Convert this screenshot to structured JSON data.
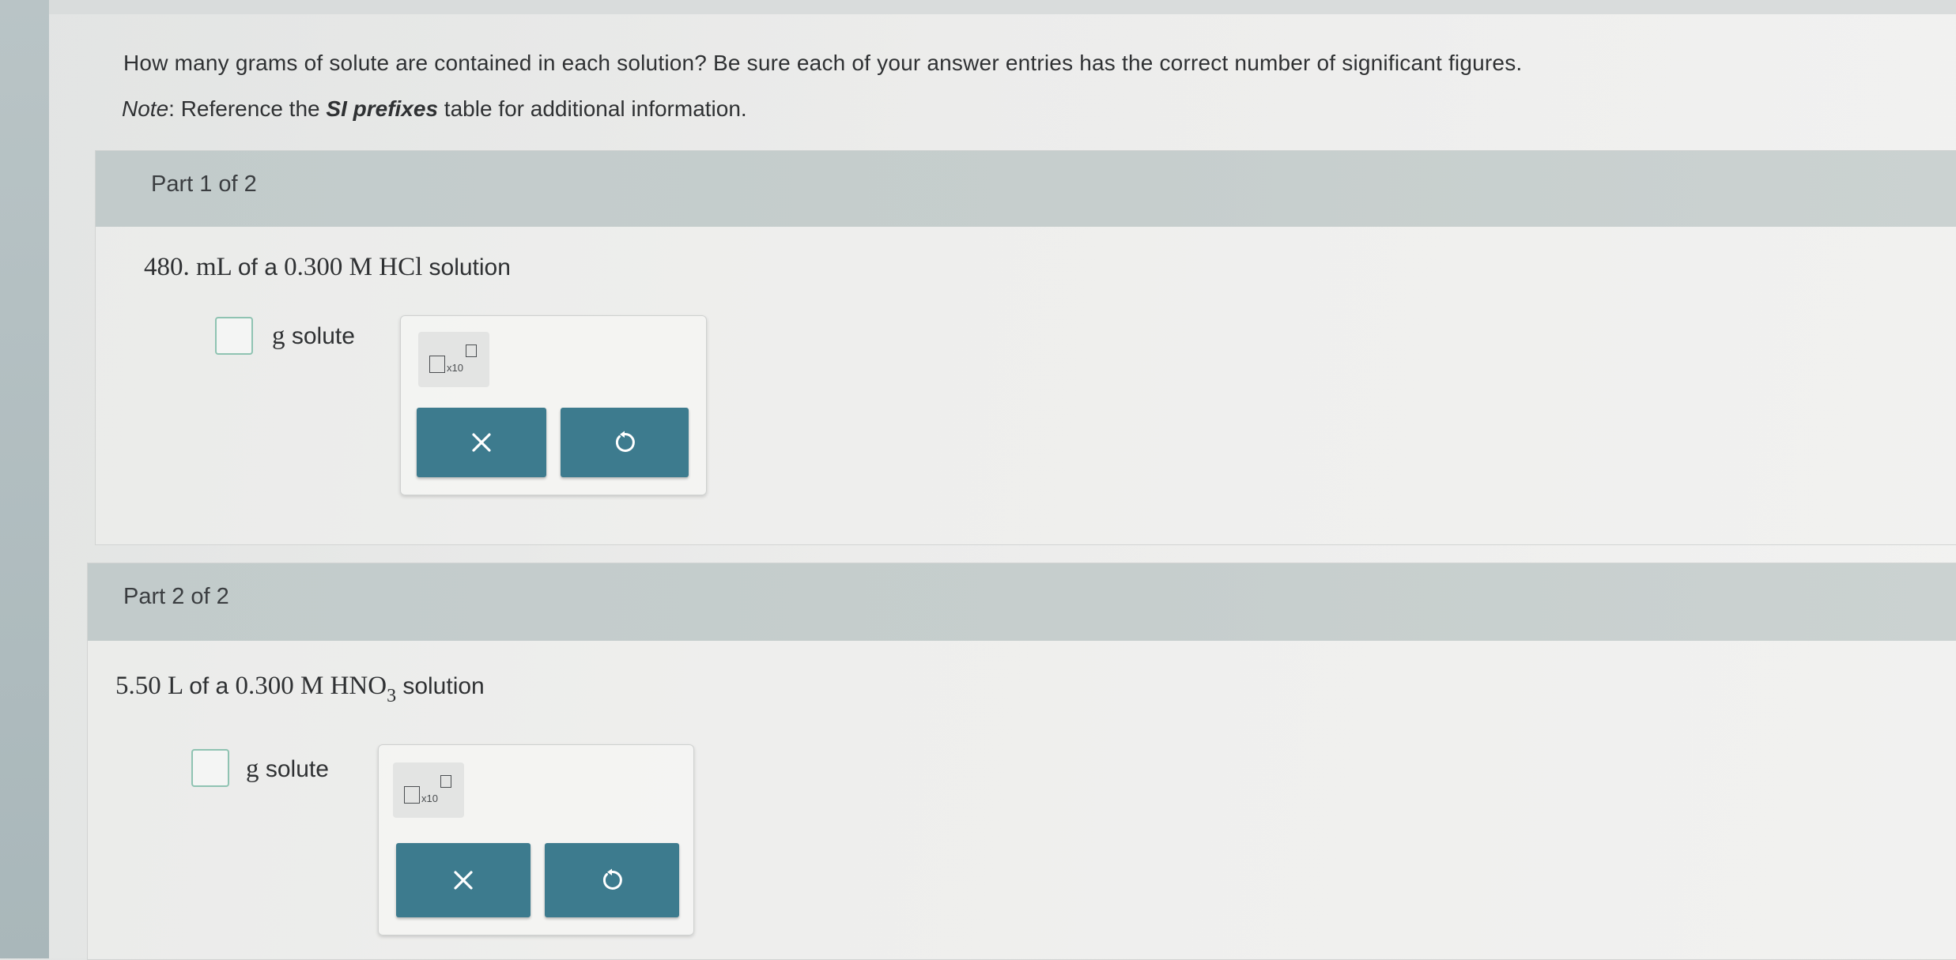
{
  "question": {
    "text": "How many grams of solute are contained in each solution? Be sure each of your answer entries has the correct number of significant figures.",
    "note_label": "Note",
    "note_prefix": ": Reference the ",
    "note_emphasis": "SI prefixes",
    "note_suffix": " table for additional information."
  },
  "parts": [
    {
      "title": "Part 1 of 2",
      "problem_amount": "480. mL",
      "problem_of": "of a",
      "problem_conc": "0.300 M HCl",
      "problem_formula_sub": "",
      "problem_suffix": "solution",
      "unit_g": "g",
      "unit_text": "solute",
      "sci_x10": "x10"
    },
    {
      "title": "Part 2 of 2",
      "problem_amount": "5.50 L",
      "problem_of": "of a",
      "problem_conc": "0.300 M HNO",
      "problem_formula_sub": "3",
      "problem_suffix": "solution",
      "unit_g": "g",
      "unit_text": "solute",
      "sci_x10": "x10"
    }
  ],
  "colors": {
    "header_bar": "#c4cccc",
    "action_button": "#3d7b8e",
    "answer_box_border": "#8fc3b2"
  },
  "icons": {
    "clear": "close-icon",
    "undo": "undo-icon",
    "scientific_notation": "x10-notation-icon"
  }
}
